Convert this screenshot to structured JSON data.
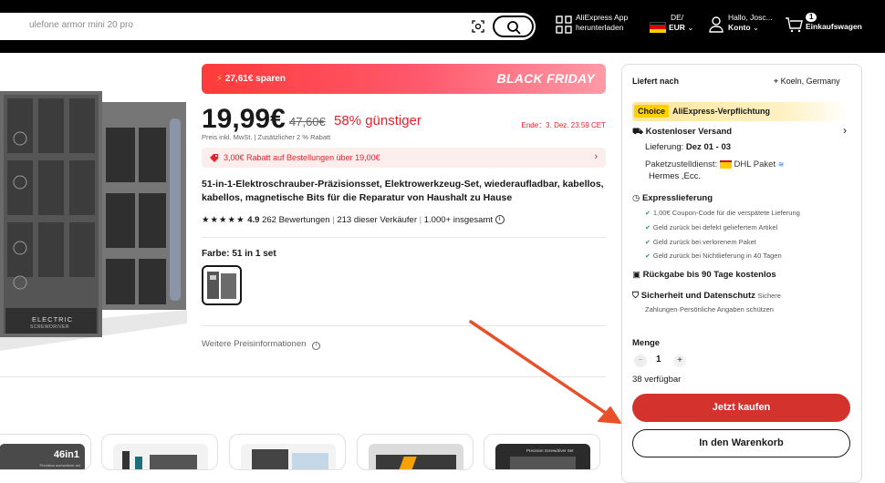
{
  "header": {
    "search_placeholder": "ulefone armor mini 20 pro",
    "app_line1": "AliExpress App",
    "app_line2": "herunterladen",
    "locale_line1": "DE/",
    "locale_line2": "EUR",
    "account_line1": "Hallo, Josc...",
    "account_line2": "Konto",
    "cart_count": "1",
    "cart_label": "Einkaufswagen"
  },
  "product": {
    "image_text1": "ELECTRIC",
    "image_text2": "SCREWDRIVER",
    "banner_save": "27,61€ sparen",
    "banner_event": "BLACK FRIDAY",
    "price": "19,99€",
    "old_price": "47,60€",
    "discount": "58% günstiger",
    "ends": "Ende：3. Dez. 23:59 CET",
    "tax_note": "Preis inkl. MwSt. | Zusätzlicher 2 % Rabatt",
    "coupon": "3,00€ Rabatt auf Bestellungen über 19,00€",
    "title": "51-in-1-Elektroschrauber-Präzisionsset, Elektrowerkzeug-Set, wiederaufladbar, kabellos, kabellos, magnetische Bits für die Reparatur von Haushalt zu Hause",
    "rating_value": "4.9",
    "reviews": "262 Bewertungen",
    "sold": "213 dieser Verkäufer",
    "total": "1.000+ insgesamt",
    "color_label": "Farbe: 51 in 1 set",
    "more_price_info": "Weitere Preisinformationen"
  },
  "thumbnails": {
    "first_label": "46in1",
    "first_sub": "Precision screwdriver set",
    "last_label": "Precision Screwdriver Set"
  },
  "panel": {
    "ship_to_label": "Liefert nach",
    "ship_to_location": "Koeln, Germany",
    "choice_tag": "Choice",
    "choice_text": "AliExpress-Verpflichtung",
    "free_shipping": "Kostenloser Versand",
    "delivery_prefix": "Lieferung: ",
    "delivery_dates": "Dez 01 - 03",
    "carrier_prefix": "Paketzustelldienst: ",
    "carrier_name": "DHL Paket",
    "carrier_more": "Hermes ,Ecc.",
    "express_title": "Expresslieferung",
    "express_items": [
      "1,00€ Coupon-Code für die verspätete Lieferung",
      "Geld zurück bei defekt geliefertem Artikel",
      "Geld zurück bei verlorenem Paket",
      "Geld zurück bei Nichtlieferung in 40 Tagen"
    ],
    "returns": "Rückgabe bis 90 Tage kostenlos",
    "security_title": "Sicherheit und Datenschutz",
    "security_line1": "Sichere",
    "security_line2": "Zahlungen·Persönliche Angaben schützen",
    "qty_label": "Menge",
    "qty_minus": "−",
    "qty_value": "1",
    "qty_plus": "+",
    "available": "38 verfügbar",
    "buy_now": "Jetzt kaufen",
    "add_to_cart": "In den Warenkorb"
  },
  "colors": {
    "accent_red": "#d3322d",
    "choice_yellow": "#ffd000",
    "annotation_arrow": "#e8502a"
  }
}
